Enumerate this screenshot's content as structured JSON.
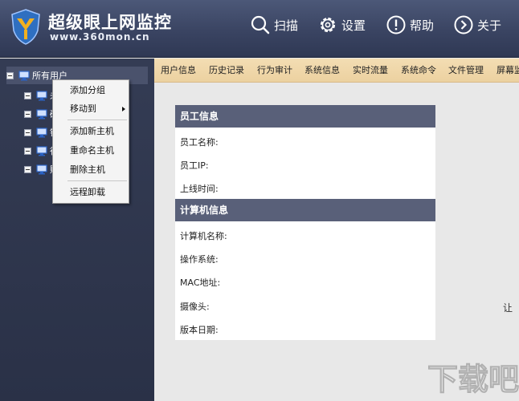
{
  "header": {
    "title": "超级眼上网监控",
    "url": "www.360mon.cn",
    "nav": [
      {
        "label": "扫描",
        "icon": "search-icon"
      },
      {
        "label": "设置",
        "icon": "gear-icon"
      },
      {
        "label": "帮助",
        "icon": "help-icon"
      },
      {
        "label": "关于",
        "icon": "chevron-right-circle-icon"
      }
    ],
    "logo_color": "#f2b01e",
    "bg_color": "#3a4462"
  },
  "tree": {
    "root_label": "所有用户",
    "children": [
      "未",
      "研",
      "销",
      "行",
      "财"
    ]
  },
  "context_menu": {
    "items": [
      "添加分组",
      "移动到",
      "添加新主机",
      "重命名主机",
      "删除主机",
      "远程卸载"
    ]
  },
  "tabs": [
    "用户信息",
    "历史记录",
    "行为审计",
    "系统信息",
    "实时流量",
    "系统命令",
    "文件管理",
    "屏幕监"
  ],
  "employee_section": {
    "title": "员工信息",
    "fields": [
      "员工名称:",
      "员工IP:",
      "上线时间:"
    ]
  },
  "computer_section": {
    "title": "计算机信息",
    "fields": [
      "计算机名称:",
      "操作系统:",
      "MAC地址:",
      "摄像头:",
      "版本日期:"
    ]
  },
  "side_text": "让",
  "watermark": "下载吧",
  "colors": {
    "tab_bar": "#ecd1a0",
    "section_head": "#596079",
    "tree_bg": "#2f3750"
  }
}
